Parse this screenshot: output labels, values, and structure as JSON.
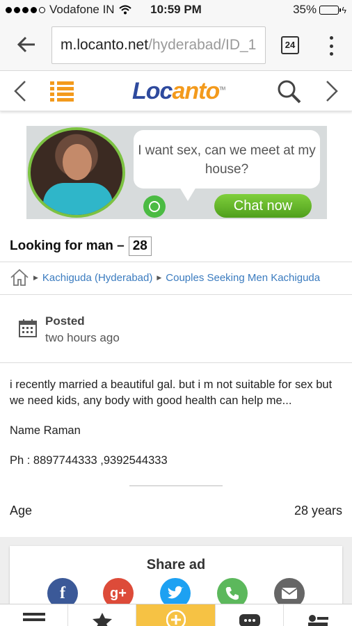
{
  "status_bar": {
    "carrier": "Vodafone IN",
    "time": "10:59 PM",
    "battery": "35%",
    "battery_level": 0.35
  },
  "browser": {
    "url_host": "m.locanto.net",
    "url_path": "/hyderabad/ID_1",
    "tab_count": "24"
  },
  "site": {
    "logo": {
      "part1": "Lo",
      "part2": "c",
      "part3": "anto",
      "tm": "TM"
    }
  },
  "banner": {
    "bubble_text": "I want sex, can we meet at my house?",
    "cta": "Chat now"
  },
  "listing": {
    "title": "Looking for man –",
    "age_badge": "28"
  },
  "breadcrumb": {
    "items": [
      "Kachiguda (Hyderabad)",
      "Couples Seeking Men Kachiguda"
    ]
  },
  "posted": {
    "label": "Posted",
    "value": "two hours ago"
  },
  "description": {
    "paragraphs": [
      "i recently married a beautiful gal. but i m not suitable for sex but we need kids, any body with good health can help me...",
      "Name Raman",
      "Ph : 8897744333 ,9392544333"
    ]
  },
  "details": {
    "age_label": "Age",
    "age_value": "28 years"
  },
  "share": {
    "title": "Share ad",
    "icons": [
      "facebook-icon",
      "google-plus-icon",
      "twitter-icon",
      "phone-icon",
      "email-icon"
    ]
  },
  "bottom_nav": [
    "menu-icon",
    "star-icon",
    "add-icon",
    "chat-icon",
    "user-icon"
  ],
  "colors": {
    "brand_blue": "#2e4a9e",
    "brand_orange": "#f39a1c",
    "link_blue": "#3a7bbf",
    "post_yellow": "#f6c244"
  }
}
